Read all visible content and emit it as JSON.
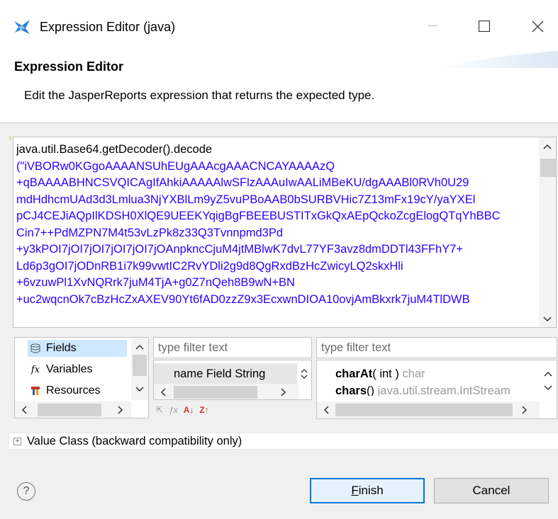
{
  "window": {
    "title": "Expression Editor (java)",
    "minimize_glyph": "—",
    "maximize_glyph": "☐",
    "close_glyph": "✕"
  },
  "header": {
    "title": "Expression Editor",
    "description": "Edit the JasperReports expression that returns the expected type."
  },
  "editor": {
    "lines": [
      "java.util.Base64.getDecoder().decode",
      "(\"iVBORw0KGgoAAAANSUhEUgAAAcgAAACNCAYAAAAzQ",
      "+qBAAAABHNCSVQICAgIfAhkiAAAAAlwSFlzAAAuIwAALiMBeKU/dgAAABl0RVh0U29",
      "mdHdhcmUAd3d3Lmlua3NjYXBlLm9yZ5vuPBoAAB0bSURBVHic7Z13mFx19cY/yaYXEl",
      "pCJ4CEJiAQpIlKDSH0XlQE9UEEKYqigBgFBEEBUSTITxGkQxAEpQckoZcgElogQTqYhBBC",
      "Cin7++PdMZPN7M4t53vLzPk8z33Q3Tvnnpmd3Pd",
      "+y3kPOI7jOI7jOI7jOI7jOI7jOAnpkncCjuM4jtMBlwK7dvL77YF3avz8dmDDTl43FFhY7+",
      "Ld6p3gOI7jODnRB1i7k99vwtIC2RvYDli2g9d8QgRxdBzHcZwicyLQ2skxHli",
      "+6vzuwPl1XvNQRrk7juM4TjA+g0Z7nQeh8B9wN+BN",
      "+uc2wqcnOk7cBzHcZxAXEV90Yt6fAD0zzZ9x3EcxwnDIOA10ovjAmBkxrk7juM4TlDWB"
    ],
    "marker_glyph": "♀"
  },
  "fields_panel": {
    "items": [
      {
        "icon": "☰",
        "label": "Fields"
      },
      {
        "icon": "fx",
        "label": "Variables"
      },
      {
        "icon": "♜",
        "label": "Resources"
      }
    ]
  },
  "middle_panel": {
    "filter_placeholder": "type filter text",
    "row": "name Field String"
  },
  "right_panel": {
    "filter_placeholder": "type filter text",
    "functions": [
      {
        "name": "charAt",
        "args": "( int )",
        "returns": "char"
      },
      {
        "name": "chars",
        "args": "()",
        "returns": "java.util.stream.IntStream"
      }
    ]
  },
  "toolbar_glyphs": [
    "⇱",
    "ƒx",
    "A↓",
    "Z↑"
  ],
  "value_class": {
    "expander": "+",
    "label": "Value Class (backward compatibility only)"
  },
  "buttons": {
    "help": "?",
    "finish_first": "F",
    "finish_rest": "inish",
    "cancel": "Cancel"
  }
}
